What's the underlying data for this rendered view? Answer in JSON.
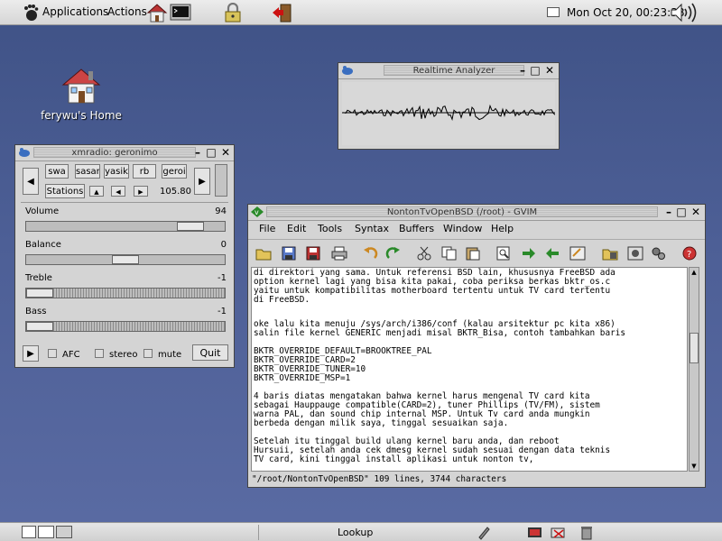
{
  "top_panel": {
    "menus": [
      "Applications",
      "Actions"
    ],
    "launchers": [
      "home-launcher-icon",
      "terminal-launcher-icon",
      "lock-screen-icon",
      "logout-icon"
    ],
    "clock": "Mon Oct 20, 00:23:38"
  },
  "desktop": {
    "home_label": "ferywu's Home"
  },
  "analyzer": {
    "title": "Realtime Analyzer"
  },
  "xmradio": {
    "title": "xmradio: geronimo",
    "presets": [
      "swa",
      "sasar",
      "yasik",
      "rb",
      "geroi"
    ],
    "stations_label": "Stations",
    "frequency": "105.80",
    "sliders": [
      {
        "label": "Volume",
        "value": "94",
        "level": 0.88
      },
      {
        "label": "Balance",
        "value": "0",
        "level": 0.5
      },
      {
        "label": "Treble",
        "value": "-1",
        "level": 0.0
      },
      {
        "label": "Bass",
        "value": "-1",
        "level": 0.0
      }
    ],
    "afc_label": "AFC",
    "stereo_label": "stereo",
    "mute_label": "mute",
    "quit_label": "Quit"
  },
  "gvim": {
    "title": "NontonTvOpenBSD (/root) - GVIM",
    "menus": [
      "File",
      "Edit",
      "Tools",
      "Syntax",
      "Buffers",
      "Window",
      "Help"
    ],
    "lines": [
      "di direktori yang sama. Untuk referensi BSD lain, khususnya FreeBSD ada",
      "option kernel lagi yang bisa kita pakai, coba periksa berkas bktr_os.c",
      "yaitu untuk kompatibilitas motherboard tertentu untuk TV card tertentu",
      "di FreeBSD.",
      "",
      "",
      "oke lalu kita menuju /sys/arch/i386/conf (kalau arsitektur pc kita x86)",
      "salin file kernel GENERIC menjadi misal BKTR_Bisa, contoh tambahkan baris",
      "",
      "BKTR_OVERRIDE_DEFAULT=BROOKTREE_PAL",
      "BKTR_OVERRIDE_CARD=2",
      "BKTR_OVERRIDE_TUNER=10",
      "BKTR_OVERRIDE_MSP=1",
      "",
      "4 baris diatas mengatakan bahwa kernel harus mengenal TV card kita",
      "sebagai Hauppauge compatible(CARD=2), tuner Phillips (TV/FM), sistem",
      "warna PAL, dan sound chip internal MSP. Untuk Tv card anda mungkin",
      "berbeda dengan milik saya, tinggal sesuaikan saja.",
      "",
      "Setelah itu tinggal build ulang kernel baru anda, dan reboot",
      "Hursuii, setelah anda cek dmesg kernel sudah sesuai dengan data teknis",
      "TV card, kini tinggal install aplikasi untuk nonton tv,"
    ],
    "status": "\"/root/NontonTvOpenBSD\" 109 lines, 3744 characters"
  },
  "bottom_panel": {
    "task_label": "Lookup"
  }
}
